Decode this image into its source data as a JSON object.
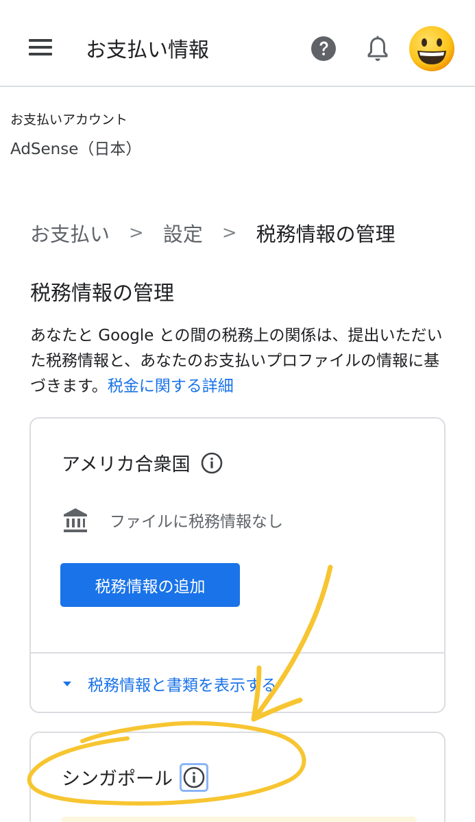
{
  "appbar": {
    "title": "お支払い情報",
    "menu_icon": "hamburger-menu-icon",
    "help_icon": "help-circle-icon",
    "notifications_icon": "bell-icon",
    "avatar_icon": "smiley-face-avatar"
  },
  "account": {
    "label": "お支払いアカウント",
    "name": "AdSense（日本）"
  },
  "breadcrumb": {
    "items": [
      "お支払い",
      "設定"
    ],
    "current": "税務情報の管理",
    "separator": ">"
  },
  "page": {
    "title": "税務情報の管理",
    "description": "あなたと Google との間の税務上の関係は、提出いただいた税務情報と、あなたのお支払いプロファイルの情報に基づきます。",
    "learn_more_link": "税金に関する詳細"
  },
  "cards": {
    "us": {
      "country": "アメリカ合衆国",
      "status_text": "ファイルに税務情報なし",
      "add_button_label": "税務情報の追加",
      "expand_label": "税務情報と書類を表示する"
    },
    "sg": {
      "country": "シンガポール"
    }
  },
  "colors": {
    "primary_blue": "#1a73e8",
    "text_primary": "#202124",
    "text_secondary": "#5f6368",
    "border": "#dadce0",
    "annotation_yellow": "#f7c531",
    "alert_background": "#fef7e0"
  }
}
